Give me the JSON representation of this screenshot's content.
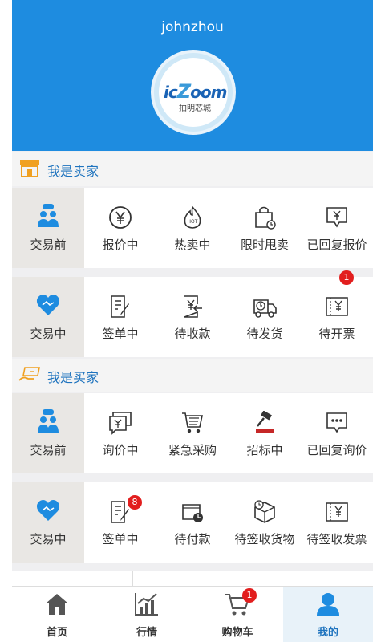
{
  "colors": {
    "accent": "#1e8ce0",
    "link": "#1e73be",
    "badge": "#e21e1e",
    "seller_icon": "#f0a020"
  },
  "user": {
    "name": "johnzhou"
  },
  "logo": {
    "brand": "icZoom",
    "brand_prefix": "ic",
    "brand_z": "Z",
    "brand_rest": "oom",
    "subtitle": "拍明芯城"
  },
  "seller": {
    "title": "我是卖家",
    "pre_trade": {
      "label": "交易前",
      "items": [
        {
          "label": "报价中",
          "icon": "yen-circle-icon"
        },
        {
          "label": "热卖中",
          "icon": "hot-flame-icon"
        },
        {
          "label": "限时甩卖",
          "icon": "timed-bag-icon"
        },
        {
          "label": "已回复报价",
          "icon": "yen-message-icon"
        }
      ]
    },
    "in_trade": {
      "label": "交易中",
      "items": [
        {
          "label": "签单中",
          "icon": "sign-document-icon",
          "badge": ""
        },
        {
          "label": "待收款",
          "icon": "receive-payment-icon",
          "badge": ""
        },
        {
          "label": "待发货",
          "icon": "delivery-truck-icon",
          "badge": ""
        },
        {
          "label": "待开票",
          "icon": "invoice-icon",
          "badge": "1"
        }
      ]
    }
  },
  "buyer": {
    "title": "我是买家",
    "pre_trade": {
      "label": "交易前",
      "items": [
        {
          "label": "询价中",
          "icon": "inquiry-icon"
        },
        {
          "label": "紧急采购",
          "icon": "cart-list-icon"
        },
        {
          "label": "招标中",
          "icon": "gavel-icon"
        },
        {
          "label": "已回复询价",
          "icon": "chat-dots-icon"
        }
      ]
    },
    "in_trade": {
      "label": "交易中",
      "items": [
        {
          "label": "签单中",
          "icon": "sign-document-icon",
          "badge": "8"
        },
        {
          "label": "待付款",
          "icon": "wallet-clock-icon",
          "badge": ""
        },
        {
          "label": "待签收货物",
          "icon": "package-clock-icon",
          "badge": ""
        },
        {
          "label": "待签收发票",
          "icon": "invoice-icon",
          "badge": ""
        }
      ]
    }
  },
  "tabs": [
    {
      "label": "首页",
      "icon": "home-icon"
    },
    {
      "label": "行情",
      "icon": "chart-icon"
    },
    {
      "label": "购物车",
      "icon": "cart-icon",
      "badge": "1"
    },
    {
      "label": "我的",
      "icon": "user-icon",
      "active": true
    }
  ]
}
